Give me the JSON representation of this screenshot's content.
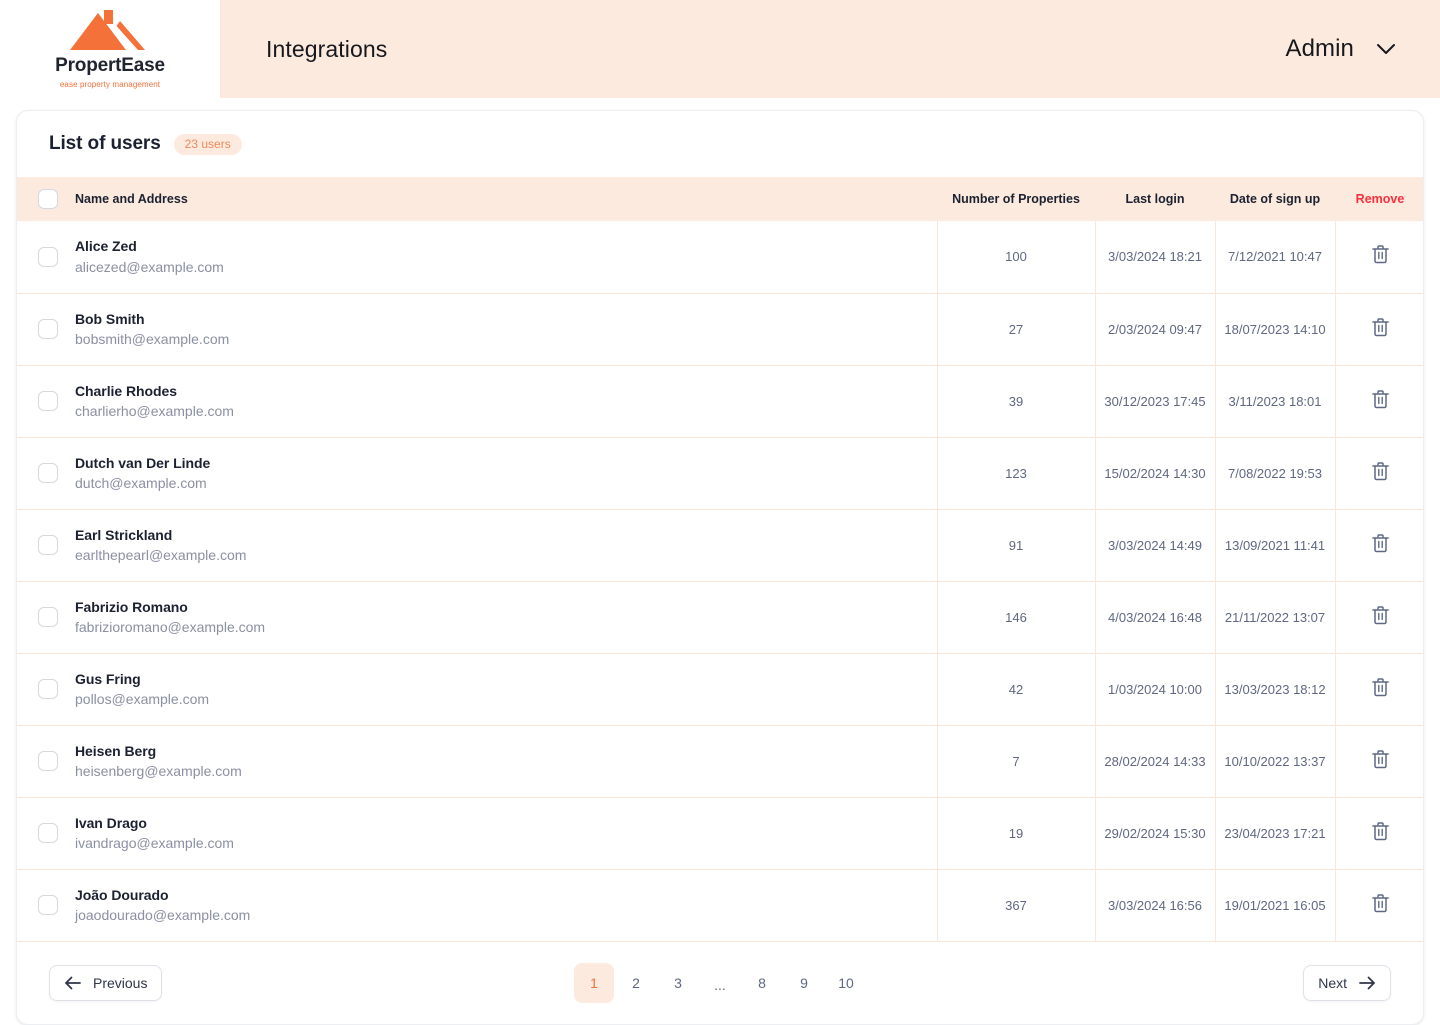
{
  "brand": {
    "name": "PropertEase",
    "tagline": "ease property management",
    "logo_icon": "house-roof-icon",
    "accent": "#f4713a"
  },
  "header": {
    "title": "Integrations",
    "account_label": "Admin",
    "chevron_icon": "chevron-down-icon",
    "background": "#fdeadf"
  },
  "card": {
    "title": "List of users",
    "badge": "23 users"
  },
  "table": {
    "columns": {
      "name": "Name and Address",
      "properties": "Number of Properties",
      "last_login": "Last login",
      "signup": "Date of sign up",
      "remove": "Remove"
    },
    "remove_color": "#f9303c",
    "remove_icon": "trash-icon",
    "rows": [
      {
        "name": "Alice Zed",
        "email": "alicezed@example.com",
        "properties": "100",
        "last_login": "3/03/2024 18:21",
        "signup": "7/12/2021 10:47"
      },
      {
        "name": "Bob Smith",
        "email": "bobsmith@example.com",
        "properties": "27",
        "last_login": "2/03/2024 09:47",
        "signup": "18/07/2023 14:10"
      },
      {
        "name": "Charlie Rhodes",
        "email": "charlierho@example.com",
        "properties": "39",
        "last_login": "30/12/2023 17:45",
        "signup": "3/11/2023 18:01"
      },
      {
        "name": "Dutch van Der Linde",
        "email": "dutch@example.com",
        "properties": "123",
        "last_login": "15/02/2024 14:30",
        "signup": "7/08/2022 19:53"
      },
      {
        "name": "Earl Strickland",
        "email": "earlthepearl@example.com",
        "properties": "91",
        "last_login": "3/03/2024 14:49",
        "signup": "13/09/2021 11:41"
      },
      {
        "name": "Fabrizio Romano",
        "email": "fabrizioromano@example.com",
        "properties": "146",
        "last_login": "4/03/2024 16:48",
        "signup": "21/11/2022 13:07"
      },
      {
        "name": "Gus Fring",
        "email": "pollos@example.com",
        "properties": "42",
        "last_login": "1/03/2024 10:00",
        "signup": "13/03/2023 18:12"
      },
      {
        "name": "Heisen Berg",
        "email": "heisenberg@example.com",
        "properties": "7",
        "last_login": "28/02/2024 14:33",
        "signup": "10/10/2022 13:37"
      },
      {
        "name": "Ivan Drago",
        "email": "ivandrago@example.com",
        "properties": "19",
        "last_login": "29/02/2024 15:30",
        "signup": "23/04/2023 17:21"
      },
      {
        "name": "João Dourado",
        "email": "joaodourado@example.com",
        "properties": "367",
        "last_login": "3/03/2024 16:56",
        "signup": "19/01/2021 16:05"
      }
    ]
  },
  "pagination": {
    "previous_label": "Previous",
    "next_label": "Next",
    "prev_icon": "arrow-left-icon",
    "next_icon": "arrow-right-icon",
    "pages": [
      "1",
      "2",
      "3",
      "...",
      "8",
      "9",
      "10"
    ],
    "active_page": "1",
    "active_bg": "#fdeadf",
    "active_color": "#f4713a"
  }
}
